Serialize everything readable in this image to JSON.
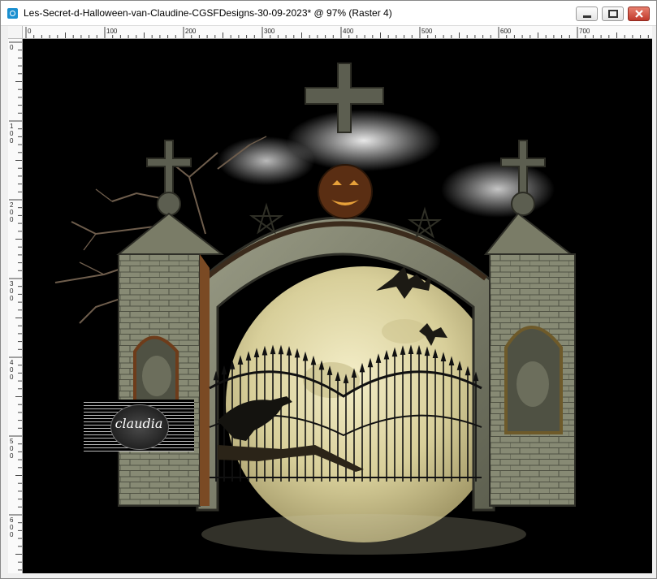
{
  "window": {
    "title": "Les-Secret-d-Halloween-van-Claudine-CGSFDesigns-30-09-2023* @  97% (Raster 4)",
    "icon": "app-image-icon"
  },
  "controls": {
    "minimize_icon": "minimize-icon",
    "maximize_icon": "maximize-icon",
    "close_icon": "close-icon"
  },
  "rulers": {
    "horizontal_labels": [
      "0",
      "100",
      "200",
      "300",
      "400",
      "500",
      "600",
      "700"
    ],
    "vertical_labels": [
      "0",
      "100",
      "200",
      "300",
      "400",
      "500",
      "600"
    ]
  },
  "canvas": {
    "background": "#000000",
    "watermark_text": "claudia"
  },
  "colors": {
    "close_button": "#c0392b",
    "app_icon": "#1a8fd0",
    "stone": "#7d7f6b",
    "moon": "#e6dfb4"
  }
}
